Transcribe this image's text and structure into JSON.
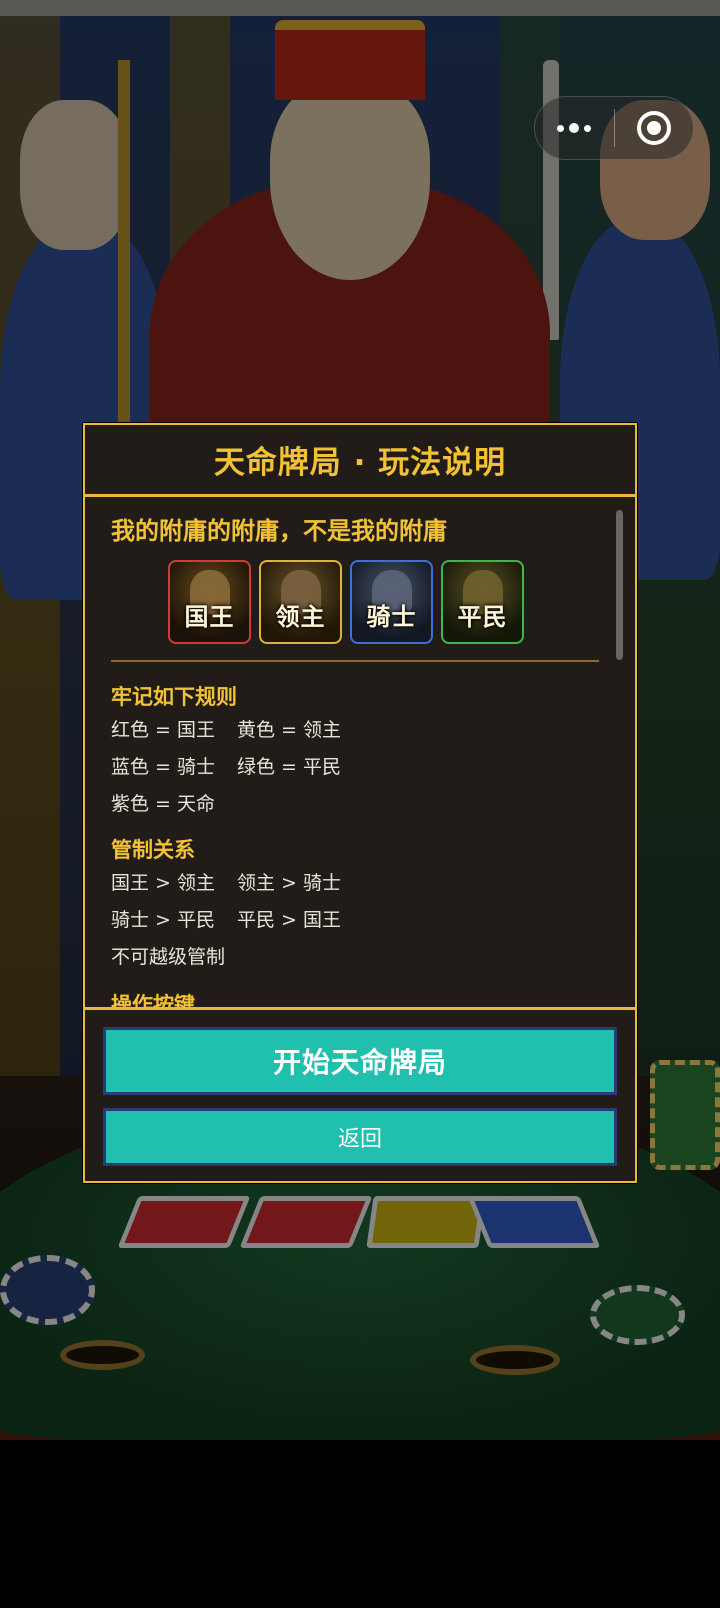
{
  "modal": {
    "title": "天命牌局 · 玩法说明",
    "intro_heading": "我的附庸的附庸，不是我的附庸",
    "role_cards": [
      {
        "label": "国王",
        "border_color": "#d23a3a"
      },
      {
        "label": "领主",
        "border_color": "#d8b43a"
      },
      {
        "label": "骑士",
        "border_color": "#3f6fd6"
      },
      {
        "label": "平民",
        "border_color": "#3db64a"
      }
    ],
    "sections": {
      "rules": {
        "title": "牢记如下规则",
        "lines": [
          [
            "红色 = 国王",
            "黄色 = 领主"
          ],
          [
            "蓝色 = 骑士",
            "绿色 = 平民"
          ],
          [
            "紫色 = 天命"
          ]
        ]
      },
      "control": {
        "title": "管制关系",
        "lines": [
          [
            "国王 > 领主",
            "领主 > 骑士"
          ],
          [
            "骑士 > 平民",
            "平民 > 国王"
          ],
          [
            "不可越级管制"
          ]
        ]
      },
      "operation": {
        "title": "操作按键"
      }
    },
    "buttons": {
      "start_label": "开始天命牌局",
      "back_label": "返回"
    }
  },
  "capsule": {
    "more_icon": "more-dots-icon",
    "close_icon": "close-circle-icon"
  },
  "colors": {
    "accent_gold": "#f2c236",
    "button_teal": "#20bfae",
    "button_border": "#2a3a78",
    "panel_bg": "#221c18"
  }
}
